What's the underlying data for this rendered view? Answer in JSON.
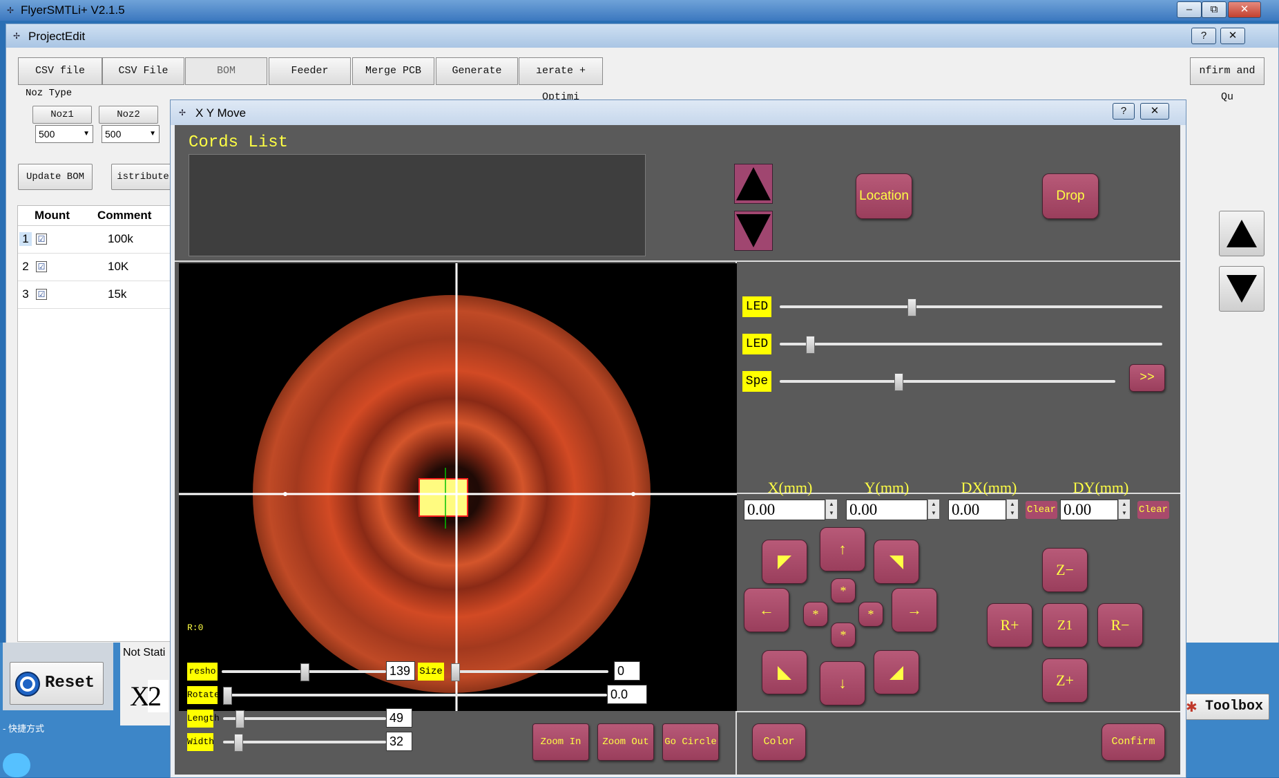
{
  "app": {
    "title": "FlyerSMTLi+ V2.1.5",
    "window_buttons": [
      "–",
      "⧉",
      "✕"
    ]
  },
  "project": {
    "title": "ProjectEdit",
    "window_buttons": [
      "?",
      "✕"
    ],
    "tabs": [
      "CSV file",
      "CSV File",
      "BOM",
      "Feeder",
      "Merge PCB",
      "Generate",
      "ıerate + Optimi"
    ],
    "confirm_button": "nfirm and Qu",
    "noz_group_label": "Noz Type",
    "noz1_label": "Noz1",
    "noz2_label": "Noz2",
    "noz1_value": "500",
    "noz2_value": "500",
    "update_bom": "Update BOM",
    "distribute": "istribute",
    "grid": {
      "headers": [
        "Mount",
        "Comment"
      ],
      "rows": [
        {
          "num": "1",
          "checked": "☑",
          "comment": "100k"
        },
        {
          "num": "2",
          "checked": "☑",
          "comment": "10K"
        },
        {
          "num": "3",
          "checked": "☑",
          "comment": "15k"
        }
      ]
    }
  },
  "bottom": {
    "reset_label": "Reset",
    "not_station": "Not Stati",
    "x_label": "X",
    "x_value": "2",
    "toolbox_label": "Toolbox",
    "footer_text": "- 快捷方式"
  },
  "xy": {
    "title": "X Y Move",
    "window_buttons": [
      "?",
      "✕"
    ],
    "cords_label": "Cords List",
    "location_button": "Location",
    "drop_button": "Drop",
    "led1_label": "LED",
    "led2_label": "LED",
    "speed_label": "Spe",
    "expand_button": ">>",
    "axes": [
      {
        "label": "X(mm)",
        "value": "0.00"
      },
      {
        "label": "Y(mm)",
        "value": "0.00"
      },
      {
        "label": "DX(mm)",
        "value": "0.00"
      },
      {
        "label": "DY(mm)",
        "value": "0.00"
      }
    ],
    "clear_label": "Clear",
    "jog": {
      "up": "↑",
      "down": "↓",
      "left": "←",
      "right": "→",
      "star": "*"
    },
    "z_minus": "Z−",
    "z_plus": "Z+",
    "z1": "Z1",
    "r_plus": "R+",
    "r_minus": "R−",
    "color_button": "Color",
    "confirm_button": "Confirm",
    "zoom_in": "Zoom In",
    "zoom_out": "Zoom Out",
    "go_circle": "Go Circle",
    "rotation_readout": "R:0",
    "threshold_label": "resho",
    "threshold_value": "139",
    "size_label": "Size",
    "size_value": "0",
    "rotate_label": "Rotate",
    "rotate_value": "0.0",
    "length_label": "Length",
    "length_value": "49",
    "width_label": "Width",
    "width_value": "32",
    "sliders": {
      "led1_level": 0.34,
      "led2_level": 0.07,
      "speed_level": 0.35,
      "threshold_level": 0.5,
      "size_level": 0.0,
      "rotate_level": 0.0,
      "length_level": 0.08,
      "width_level": 0.07
    },
    "colors": {
      "accent_button": "#a84a6c",
      "label_yellow": "#ffff44",
      "panel_gray": "#5a5a5a"
    }
  }
}
